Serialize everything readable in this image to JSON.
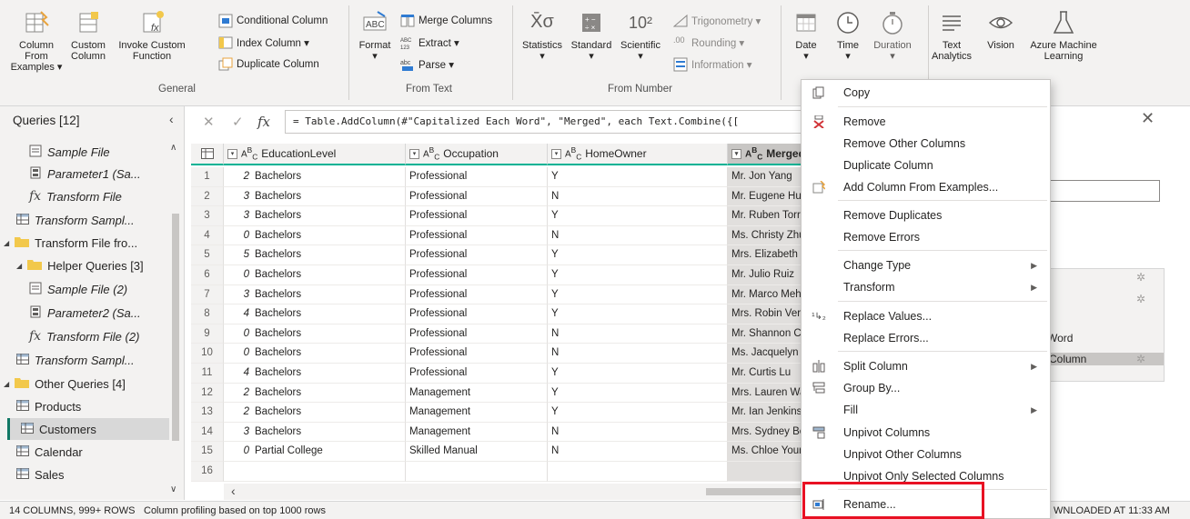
{
  "ribbon": {
    "general": {
      "label": "General",
      "col_from_examples": [
        "Column From",
        "Examples ▾"
      ],
      "custom_column": [
        "Custom",
        "Column"
      ],
      "invoke_custom_function": [
        "Invoke Custom",
        "Function"
      ],
      "conditional_column": "Conditional Column",
      "index_column": "Index Column ▾",
      "duplicate_column": "Duplicate Column"
    },
    "from_text": {
      "label": "From Text",
      "format": [
        "Format",
        "▾"
      ],
      "merge_columns": "Merge Columns",
      "extract": "Extract ▾",
      "parse": "Parse ▾"
    },
    "from_number": {
      "label": "From Number",
      "statistics": [
        "Statistics",
        "▾"
      ],
      "standard": [
        "Standard",
        "▾"
      ],
      "scientific": [
        "Scientific",
        "▾"
      ],
      "trigonometry": "Trigonometry ▾",
      "rounding": "Rounding ▾",
      "information": "Information ▾"
    },
    "date": [
      "Date",
      "▾"
    ],
    "time": [
      "Time",
      "▾"
    ],
    "duration": [
      "Duration",
      "▾"
    ],
    "text_analytics": [
      "Text",
      "Analytics"
    ],
    "vision": "Vision",
    "azure_ml": [
      "Azure Machine",
      "Learning"
    ]
  },
  "queries": {
    "title": "Queries [12]",
    "items": [
      {
        "label": "Sample File",
        "icon": "text-file-icon",
        "italic": true
      },
      {
        "label": "Parameter1 (Sa...",
        "icon": "parameter-icon",
        "italic": true
      },
      {
        "label": "Transform File",
        "icon": "function-icon",
        "italic": true
      },
      {
        "label": "Transform Sampl...",
        "icon": "table-icon",
        "italic": true
      },
      {
        "label": "Transform File fro...",
        "icon": "folder-icon",
        "italic": false
      },
      {
        "label": "Helper Queries [3]",
        "icon": "folder-icon",
        "italic": false
      },
      {
        "label": "Sample File (2)",
        "icon": "text-file-icon",
        "italic": true
      },
      {
        "label": "Parameter2 (Sa...",
        "icon": "parameter-icon",
        "italic": true
      },
      {
        "label": "Transform File (2)",
        "icon": "function-icon",
        "italic": true
      },
      {
        "label": "Transform Sampl...",
        "icon": "table-icon",
        "italic": true
      },
      {
        "label": "Other Queries [4]",
        "icon": "folder-icon",
        "italic": false
      },
      {
        "label": "Products",
        "icon": "table-icon",
        "italic": false
      },
      {
        "label": "Customers",
        "icon": "table-icon",
        "italic": false
      },
      {
        "label": "Calendar",
        "icon": "table-icon",
        "italic": false
      },
      {
        "label": "Sales",
        "icon": "table-icon",
        "italic": false
      }
    ]
  },
  "formula": "= Table.AddColumn(#\"Capitalized Each Word\", \"Merged\", each Text.Combine({[",
  "grid": {
    "headers": [
      "EducationLevel",
      "Occupation",
      "HomeOwner",
      "Merged"
    ],
    "rows": [
      [
        "1",
        "2",
        "Bachelors",
        "Professional",
        "Y",
        "Mr. Jon Yang"
      ],
      [
        "2",
        "3",
        "Bachelors",
        "Professional",
        "N",
        "Mr. Eugene Hu"
      ],
      [
        "3",
        "3",
        "Bachelors",
        "Professional",
        "Y",
        "Mr. Ruben Torr"
      ],
      [
        "4",
        "0",
        "Bachelors",
        "Professional",
        "N",
        "Ms. Christy Zhu"
      ],
      [
        "5",
        "5",
        "Bachelors",
        "Professional",
        "Y",
        "Mrs. Elizabeth J"
      ],
      [
        "6",
        "0",
        "Bachelors",
        "Professional",
        "Y",
        "Mr. Julio Ruiz"
      ],
      [
        "7",
        "3",
        "Bachelors",
        "Professional",
        "Y",
        "Mr. Marco Meh"
      ],
      [
        "8",
        "4",
        "Bachelors",
        "Professional",
        "Y",
        "Mrs. Robin Ver"
      ],
      [
        "9",
        "0",
        "Bachelors",
        "Professional",
        "N",
        "Mr. Shannon C"
      ],
      [
        "10",
        "0",
        "Bachelors",
        "Professional",
        "N",
        "Ms. Jacquelyn S"
      ],
      [
        "11",
        "4",
        "Bachelors",
        "Professional",
        "Y",
        "Mr. Curtis Lu"
      ],
      [
        "12",
        "2",
        "Bachelors",
        "Management",
        "Y",
        "Mrs. Lauren Wa"
      ],
      [
        "13",
        "2",
        "Bachelors",
        "Management",
        "Y",
        "Mr. Ian Jenkins"
      ],
      [
        "14",
        "3",
        "Bachelors",
        "Management",
        "N",
        "Mrs. Sydney Be"
      ],
      [
        "15",
        "0",
        "Partial College",
        "Skilled Manual",
        "N",
        "Ms. Chloe Your"
      ],
      [
        "16",
        "",
        "",
        "",
        "",
        ""
      ]
    ]
  },
  "right_pane": {
    "step_a": "rs",
    "step_b": "Word",
    "step_c": "Column"
  },
  "status": {
    "columns_rows": "14 COLUMNS, 999+ ROWS",
    "profiling": "Column profiling based on top 1000 rows",
    "downloaded": "WNLOADED AT 11:33 AM"
  },
  "menu": {
    "items": [
      {
        "label": "Copy",
        "icon": "copy-icon"
      },
      {
        "label": "Remove",
        "icon": "remove-icon"
      },
      {
        "label": "Remove Other Columns",
        "icon": ""
      },
      {
        "label": "Duplicate Column",
        "icon": ""
      },
      {
        "label": "Add Column From Examples...",
        "icon": "add-column-icon"
      },
      {
        "label": "Remove Duplicates",
        "icon": ""
      },
      {
        "label": "Remove Errors",
        "icon": ""
      },
      {
        "label": "Change Type",
        "icon": ""
      },
      {
        "label": "Transform",
        "icon": ""
      },
      {
        "label": "Replace Values...",
        "icon": "replace-values-icon"
      },
      {
        "label": "Replace Errors...",
        "icon": ""
      },
      {
        "label": "Split Column",
        "icon": "split-column-icon"
      },
      {
        "label": "Group By...",
        "icon": "group-by-icon"
      },
      {
        "label": "Fill",
        "icon": ""
      },
      {
        "label": "Unpivot Columns",
        "icon": "unpivot-icon"
      },
      {
        "label": "Unpivot Other Columns",
        "icon": ""
      },
      {
        "label": "Unpivot Only Selected Columns",
        "icon": ""
      },
      {
        "label": "Rename...",
        "icon": "rename-icon"
      }
    ]
  },
  "colors": {
    "accent": "#00b294",
    "highlight_box": "#e81123",
    "selected_query": "#117865"
  }
}
